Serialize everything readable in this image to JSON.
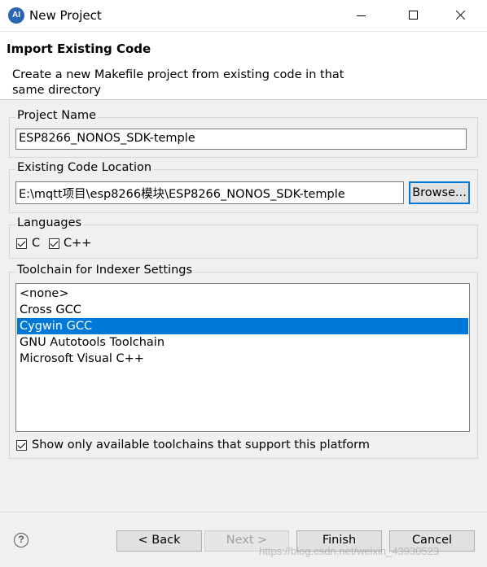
{
  "window": {
    "title": "New Project",
    "icon_text": "AI"
  },
  "header": {
    "heading": "Import Existing Code",
    "description": "Create a new Makefile project from existing code in that same directory"
  },
  "project_name": {
    "label": "Project Name",
    "value": "ESP8266_NONOS_SDK-temple"
  },
  "code_location": {
    "label": "Existing Code Location",
    "value": "E:\\mqtt项目\\esp8266模块\\ESP8266_NONOS_SDK-temple",
    "browse_label": "Browse..."
  },
  "languages": {
    "label": "Languages",
    "items": [
      {
        "label": "C",
        "checked": true
      },
      {
        "label": "C++",
        "checked": true
      }
    ]
  },
  "toolchain": {
    "label": "Toolchain for Indexer Settings",
    "items": [
      "<none>",
      "Cross GCC",
      "Cygwin GCC",
      "GNU Autotools Toolchain",
      "Microsoft Visual C++"
    ],
    "selected_index": 2,
    "show_only_label": "Show only available toolchains that support this platform",
    "show_only_checked": true
  },
  "footer": {
    "back_label": "< Back",
    "next_label": "Next >",
    "finish_label": "Finish",
    "cancel_label": "Cancel"
  },
  "watermark": "https://blog.csdn.net/weixin_43930523",
  "colors": {
    "selection": "#0078d7",
    "focus_border": "#0078d7"
  }
}
